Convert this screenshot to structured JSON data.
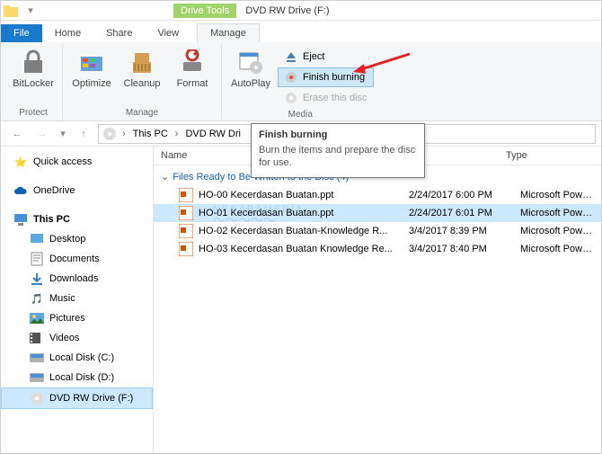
{
  "title": {
    "context_tab": "Drive Tools",
    "window_title": "DVD RW Drive (F:)"
  },
  "tabs": {
    "file": "File",
    "home": "Home",
    "share": "Share",
    "view": "View",
    "manage": "Manage"
  },
  "ribbon": {
    "protect": {
      "bitlocker": "BitLocker",
      "label": "Protect"
    },
    "manage": {
      "optimize": "Optimize",
      "cleanup": "Cleanup",
      "format": "Format",
      "label": "Manage"
    },
    "media": {
      "autoplay": "AutoPlay",
      "eject": "Eject",
      "finish_burning": "Finish burning",
      "erase": "Erase this disc",
      "label": "Media"
    }
  },
  "tooltip": {
    "title": "Finish burning",
    "body": "Burn the items and prepare the disc for use."
  },
  "breadcrumb": {
    "this_pc": "This PC",
    "drive": "DVD RW Dri"
  },
  "columns": {
    "name": "Name",
    "modified": "odified",
    "type": "Type"
  },
  "group_header": "Files Ready to Be Written to the Disc (4)",
  "files": [
    {
      "name": "HO-00 Kecerdasan Buatan.ppt",
      "date": "2/24/2017 6:00 PM",
      "type": "Microsoft PowerP..."
    },
    {
      "name": "HO-01 Kecerdasan Buatan.ppt",
      "date": "2/24/2017 6:01 PM",
      "type": "Microsoft PowerP..."
    },
    {
      "name": "HO-02 Kecerdasan Buatan-Knowledge R...",
      "date": "3/4/2017 8:39 PM",
      "type": "Microsoft PowerP..."
    },
    {
      "name": "HO-03 Kecerdasan Buatan Knowledge Re...",
      "date": "3/4/2017 8:40 PM",
      "type": "Microsoft PowerP..."
    }
  ],
  "sidebar": {
    "quick_access": "Quick access",
    "onedrive": "OneDrive",
    "this_pc": "This PC",
    "desktop": "Desktop",
    "documents": "Documents",
    "downloads": "Downloads",
    "music": "Music",
    "pictures": "Pictures",
    "videos": "Videos",
    "local_c": "Local Disk (C:)",
    "local_d": "Local Disk (D:)",
    "dvd": "DVD RW Drive (F:)"
  },
  "watermark": "NESABAMEDIA"
}
